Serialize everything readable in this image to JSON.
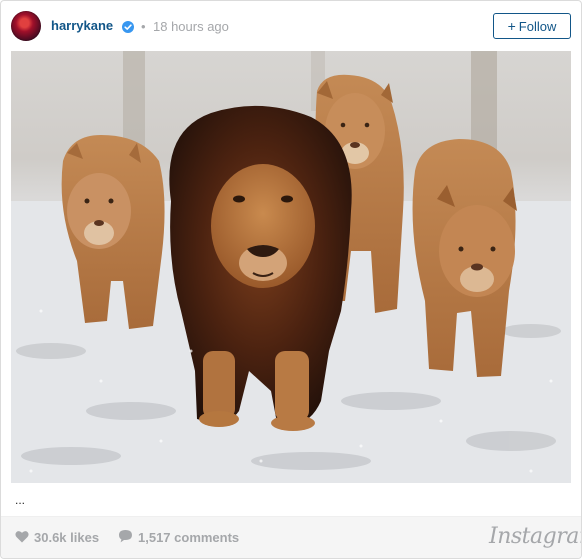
{
  "post": {
    "username": "harrykane",
    "separator": "•",
    "timestamp": "18 hours ago",
    "follow_label": "Follow",
    "caption": "...",
    "likes": "30.6k likes",
    "comments": "1,517 comments",
    "brand": "Instagram"
  },
  "icons": {
    "verified": "verified-badge-icon",
    "like": "heart-icon",
    "comment": "comment-bubble-icon"
  },
  "colors": {
    "username": "#125688",
    "verified": "#3897f0",
    "muted": "#a5a7aa",
    "footer_bg": "#f5f5f5"
  }
}
